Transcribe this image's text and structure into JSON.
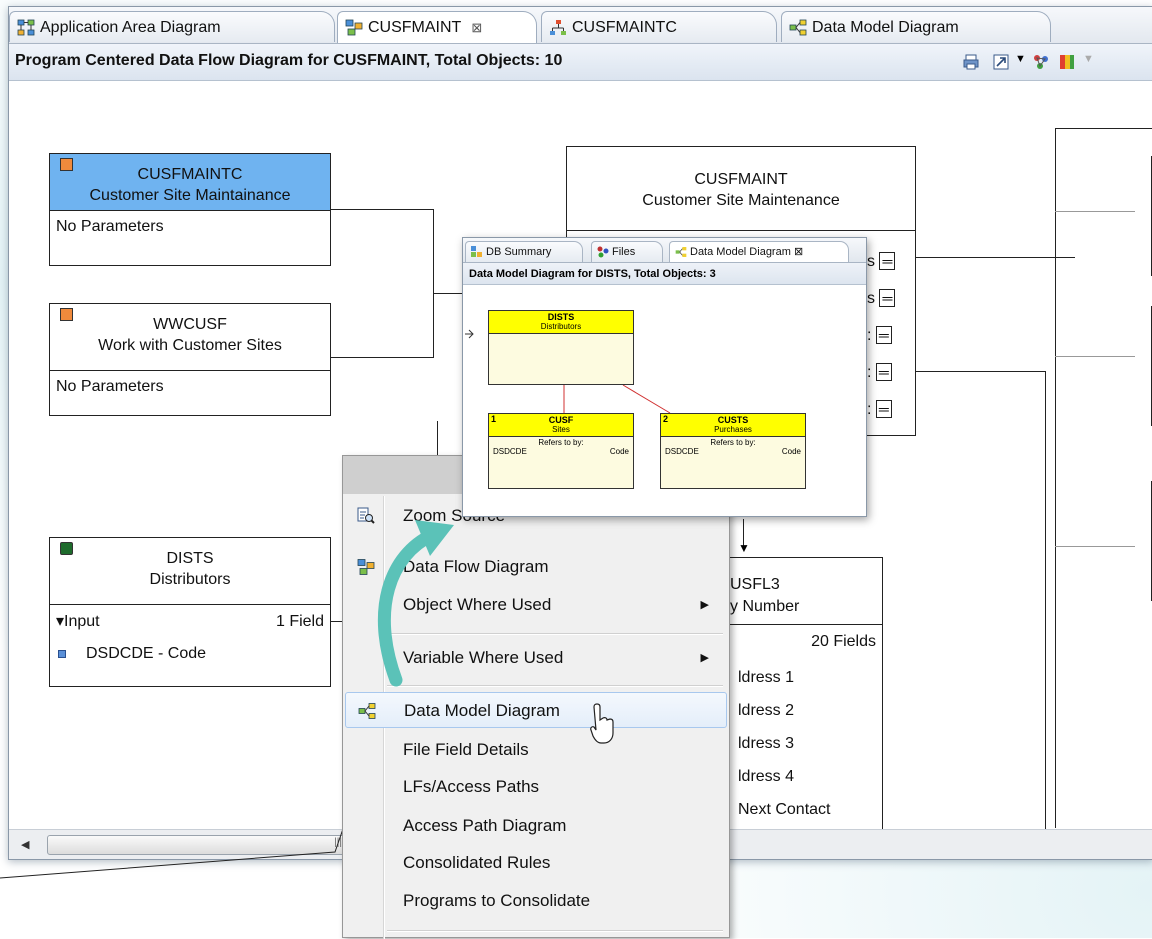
{
  "tabs": [
    {
      "label": "Application Area Diagram"
    },
    {
      "label": "CUSFMAINT",
      "close": "⊠"
    },
    {
      "label": "CUSFMAINTC"
    },
    {
      "label": "Data Model Diagram"
    }
  ],
  "diagram_title": "Program Centered Data Flow Diagram for CUSFMAINT, Total Objects: 10",
  "nodes": {
    "cusfmaintc": {
      "name": "CUSFMAINTC",
      "desc": "Customer Site Maintainance",
      "param": "No Parameters"
    },
    "wwcusf": {
      "name": "WWCUSF",
      "desc": "Work with Customer Sites",
      "param": "No Parameters"
    },
    "dists": {
      "name": "DISTS",
      "desc": "Distributors",
      "direction": "Input",
      "fieldcount": "1 Field",
      "field": "DSDCDE - Code"
    },
    "cusfmaint": {
      "name": "CUSFMAINT",
      "desc": "Customer Site Maintenance",
      "rows": [
        "s",
        "s",
        ":",
        ":",
        ":"
      ]
    },
    "cusfl3": {
      "name": "USFL3",
      "desc": "y Number",
      "fieldcount": "20 Fields",
      "fields": [
        "ldress 1",
        "ldress 2",
        "ldress 3",
        "ldress 4",
        "Next Contact"
      ]
    }
  },
  "popup": {
    "tabs": [
      {
        "label": "DB Summary"
      },
      {
        "label": "Files"
      },
      {
        "label": "Data Model Diagram",
        "close": "⊠"
      }
    ],
    "title": "Data Model Diagram for DISTS, Total Objects: 3",
    "entities": {
      "dists": {
        "name": "DISTS",
        "desc": "Distributors"
      },
      "cusf": {
        "num": "1",
        "name": "CUSF",
        "desc": "Sites",
        "refers": "Refers to by:",
        "key": "DSDCDE",
        "keydesc": "Code"
      },
      "custs": {
        "num": "2",
        "name": "CUSTS",
        "desc": "Purchases",
        "refers": "Refers to by:",
        "key": "DSDCDE",
        "keydesc": "Code"
      }
    }
  },
  "menu": {
    "items": [
      {
        "label": "Zoom Source",
        "icon": "zoom-source-icon"
      },
      {
        "label": "Data Flow Diagram",
        "icon": "data-flow-icon"
      },
      {
        "label": "Object Where Used",
        "submenu": true
      },
      {
        "label": "Variable Where Used",
        "submenu": true
      },
      {
        "label": "Data Model Diagram",
        "icon": "data-model-icon",
        "hover": true
      },
      {
        "label": "File Field Details"
      },
      {
        "label": "LFs/Access Paths"
      },
      {
        "label": "Access Path Diagram"
      },
      {
        "label": "Consolidated Rules"
      },
      {
        "label": "Programs to Consolidate"
      }
    ],
    "submenu_arrow": "▶"
  },
  "colors": {
    "selected_header": "#6fb3f0",
    "accent_arrow": "#5bc2b8",
    "entity_header": "#ffff00",
    "program_square": "#f08a3c",
    "file_square": "#1e6b2c"
  }
}
